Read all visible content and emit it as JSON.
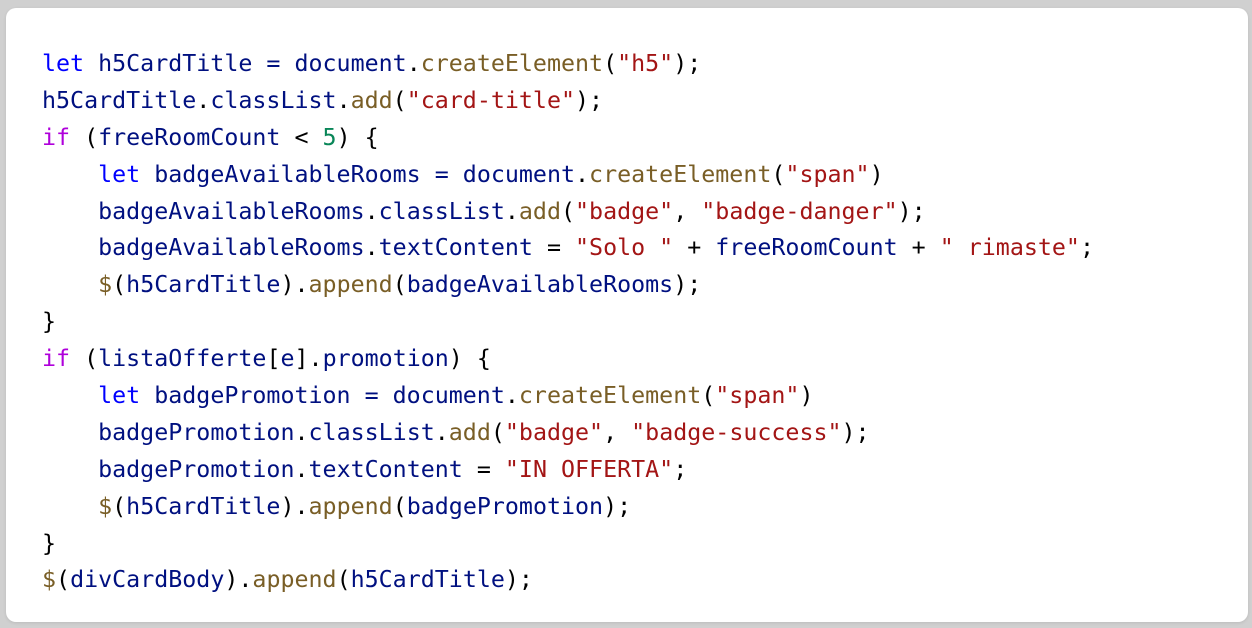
{
  "code_lines": [
    [
      {
        "text": "let",
        "cls": "kw"
      },
      {
        "text": " h5CardTitle = ",
        "cls": "var"
      },
      {
        "text": "document",
        "cls": "var"
      },
      {
        "text": ".",
        "cls": "plain"
      },
      {
        "text": "createElement",
        "cls": "fn"
      },
      {
        "text": "(",
        "cls": "plain"
      },
      {
        "text": "\"h5\"",
        "cls": "str"
      },
      {
        "text": ");",
        "cls": "plain"
      }
    ],
    [
      {
        "text": "h5CardTitle",
        "cls": "var"
      },
      {
        "text": ".",
        "cls": "plain"
      },
      {
        "text": "classList",
        "cls": "var"
      },
      {
        "text": ".",
        "cls": "plain"
      },
      {
        "text": "add",
        "cls": "fn"
      },
      {
        "text": "(",
        "cls": "plain"
      },
      {
        "text": "\"card-title\"",
        "cls": "str"
      },
      {
        "text": ");",
        "cls": "plain"
      }
    ],
    [
      {
        "text": "if",
        "cls": "kw2"
      },
      {
        "text": " (",
        "cls": "plain"
      },
      {
        "text": "freeRoomCount",
        "cls": "var"
      },
      {
        "text": " < ",
        "cls": "plain"
      },
      {
        "text": "5",
        "cls": "num"
      },
      {
        "text": ") {",
        "cls": "plain"
      }
    ],
    [
      {
        "text": "    ",
        "cls": "plain"
      },
      {
        "text": "let",
        "cls": "kw"
      },
      {
        "text": " badgeAvailableRooms = ",
        "cls": "var"
      },
      {
        "text": "document",
        "cls": "var"
      },
      {
        "text": ".",
        "cls": "plain"
      },
      {
        "text": "createElement",
        "cls": "fn"
      },
      {
        "text": "(",
        "cls": "plain"
      },
      {
        "text": "\"span\"",
        "cls": "str"
      },
      {
        "text": ")",
        "cls": "plain"
      }
    ],
    [
      {
        "text": "    ",
        "cls": "plain"
      },
      {
        "text": "badgeAvailableRooms",
        "cls": "var"
      },
      {
        "text": ".",
        "cls": "plain"
      },
      {
        "text": "classList",
        "cls": "var"
      },
      {
        "text": ".",
        "cls": "plain"
      },
      {
        "text": "add",
        "cls": "fn"
      },
      {
        "text": "(",
        "cls": "plain"
      },
      {
        "text": "\"badge\"",
        "cls": "str"
      },
      {
        "text": ", ",
        "cls": "plain"
      },
      {
        "text": "\"badge-danger\"",
        "cls": "str"
      },
      {
        "text": ");",
        "cls": "plain"
      }
    ],
    [
      {
        "text": "    ",
        "cls": "plain"
      },
      {
        "text": "badgeAvailableRooms",
        "cls": "var"
      },
      {
        "text": ".",
        "cls": "plain"
      },
      {
        "text": "textContent",
        "cls": "var"
      },
      {
        "text": " = ",
        "cls": "plain"
      },
      {
        "text": "\"Solo \"",
        "cls": "str"
      },
      {
        "text": " + ",
        "cls": "plain"
      },
      {
        "text": "freeRoomCount",
        "cls": "var"
      },
      {
        "text": " + ",
        "cls": "plain"
      },
      {
        "text": "\" rimaste\"",
        "cls": "str"
      },
      {
        "text": ";",
        "cls": "plain"
      }
    ],
    [
      {
        "text": "    ",
        "cls": "plain"
      },
      {
        "text": "$",
        "cls": "fn"
      },
      {
        "text": "(",
        "cls": "plain"
      },
      {
        "text": "h5CardTitle",
        "cls": "var"
      },
      {
        "text": ").",
        "cls": "plain"
      },
      {
        "text": "append",
        "cls": "fn"
      },
      {
        "text": "(",
        "cls": "plain"
      },
      {
        "text": "badgeAvailableRooms",
        "cls": "var"
      },
      {
        "text": ");",
        "cls": "plain"
      }
    ],
    [
      {
        "text": "}",
        "cls": "plain"
      }
    ],
    [
      {
        "text": "if",
        "cls": "kw2"
      },
      {
        "text": " (",
        "cls": "plain"
      },
      {
        "text": "listaOfferte",
        "cls": "var"
      },
      {
        "text": "[",
        "cls": "plain"
      },
      {
        "text": "e",
        "cls": "var"
      },
      {
        "text": "].",
        "cls": "plain"
      },
      {
        "text": "promotion",
        "cls": "var"
      },
      {
        "text": ") {",
        "cls": "plain"
      }
    ],
    [
      {
        "text": "    ",
        "cls": "plain"
      },
      {
        "text": "let",
        "cls": "kw"
      },
      {
        "text": " badgePromotion = ",
        "cls": "var"
      },
      {
        "text": "document",
        "cls": "var"
      },
      {
        "text": ".",
        "cls": "plain"
      },
      {
        "text": "createElement",
        "cls": "fn"
      },
      {
        "text": "(",
        "cls": "plain"
      },
      {
        "text": "\"span\"",
        "cls": "str"
      },
      {
        "text": ")",
        "cls": "plain"
      }
    ],
    [
      {
        "text": "    ",
        "cls": "plain"
      },
      {
        "text": "badgePromotion",
        "cls": "var"
      },
      {
        "text": ".",
        "cls": "plain"
      },
      {
        "text": "classList",
        "cls": "var"
      },
      {
        "text": ".",
        "cls": "plain"
      },
      {
        "text": "add",
        "cls": "fn"
      },
      {
        "text": "(",
        "cls": "plain"
      },
      {
        "text": "\"badge\"",
        "cls": "str"
      },
      {
        "text": ", ",
        "cls": "plain"
      },
      {
        "text": "\"badge-success\"",
        "cls": "str"
      },
      {
        "text": ");",
        "cls": "plain"
      }
    ],
    [
      {
        "text": "    ",
        "cls": "plain"
      },
      {
        "text": "badgePromotion",
        "cls": "var"
      },
      {
        "text": ".",
        "cls": "plain"
      },
      {
        "text": "textContent",
        "cls": "var"
      },
      {
        "text": " = ",
        "cls": "plain"
      },
      {
        "text": "\"IN OFFERTA\"",
        "cls": "str"
      },
      {
        "text": ";",
        "cls": "plain"
      }
    ],
    [
      {
        "text": "    ",
        "cls": "plain"
      },
      {
        "text": "$",
        "cls": "fn"
      },
      {
        "text": "(",
        "cls": "plain"
      },
      {
        "text": "h5CardTitle",
        "cls": "var"
      },
      {
        "text": ").",
        "cls": "plain"
      },
      {
        "text": "append",
        "cls": "fn"
      },
      {
        "text": "(",
        "cls": "plain"
      },
      {
        "text": "badgePromotion",
        "cls": "var"
      },
      {
        "text": ");",
        "cls": "plain"
      }
    ],
    [
      {
        "text": "}",
        "cls": "plain"
      }
    ],
    [
      {
        "text": "$",
        "cls": "fn"
      },
      {
        "text": "(",
        "cls": "plain"
      },
      {
        "text": "divCardBody",
        "cls": "var"
      },
      {
        "text": ").",
        "cls": "plain"
      },
      {
        "text": "append",
        "cls": "fn"
      },
      {
        "text": "(",
        "cls": "plain"
      },
      {
        "text": "h5CardTitle",
        "cls": "var"
      },
      {
        "text": ");",
        "cls": "plain"
      }
    ]
  ],
  "colors": {
    "keyword_let": "#0000ff",
    "keyword_if": "#af00db",
    "function": "#795e26",
    "string": "#a31515",
    "number": "#098658",
    "identifier": "#001080"
  }
}
